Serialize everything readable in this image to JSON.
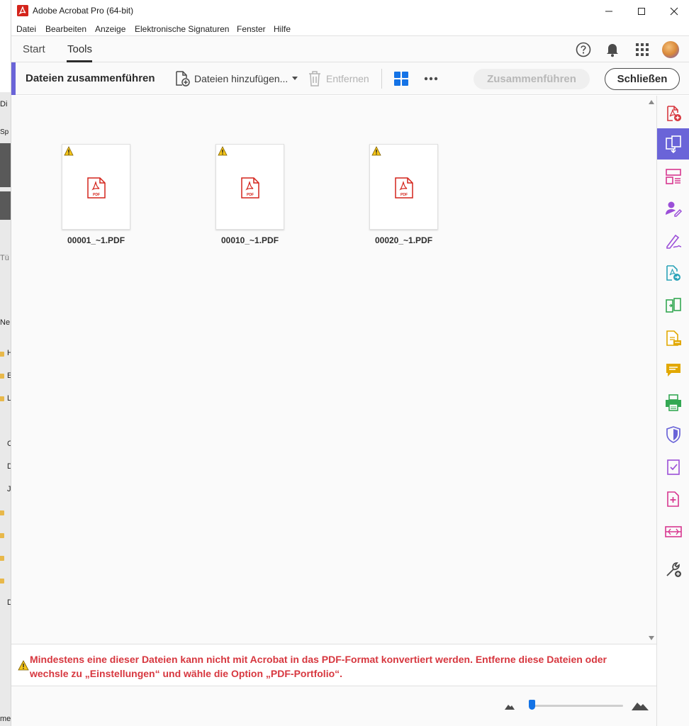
{
  "window": {
    "title": "Adobe Acrobat Pro (64-bit)"
  },
  "menu": [
    "Datei",
    "Bearbeiten",
    "Anzeige",
    "Elektronische Signaturen",
    "Fenster",
    "Hilfe"
  ],
  "tabs": {
    "start": "Start",
    "tools": "Tools",
    "active": "Tools"
  },
  "toolbar": {
    "title": "Dateien zusammenführen",
    "add_files": "Dateien hinzufügen...",
    "remove": "Entfernen",
    "merge": "Zusammenführen",
    "close": "Schließen"
  },
  "files": [
    {
      "name": "00001_~1.PDF",
      "warning": true,
      "icon": "pdf-file-icon"
    },
    {
      "name": "00010_~1.PDF",
      "warning": true,
      "icon": "pdf-file-icon"
    },
    {
      "name": "00020_~1.PDF",
      "warning": true,
      "icon": "pdf-file-icon"
    }
  ],
  "warning": {
    "line1": "Mindestens eine dieser Dateien kann nicht mit Acrobat in das PDF-Format konvertiert werden. Entferne diese Dateien oder",
    "line2": "wechsle zu „Einstellungen“ und wähle die Option „PDF-Portfolio“."
  },
  "background_window": {
    "fragments": [
      "Di",
      "Sp",
      "Tü",
      "Ne",
      "H",
      "E",
      "L",
      "C",
      "D",
      "J",
      "D",
      "me"
    ]
  },
  "rail_tools": [
    "create-pdf-icon",
    "combine-files-icon",
    "organize-pages-icon",
    "request-signature-icon",
    "fill-sign-icon",
    "export-pdf-icon",
    "compare-files-icon",
    "scan-ocr-icon",
    "comment-icon",
    "print-production-icon",
    "protect-icon",
    "prepare-form-icon",
    "add-page-icon",
    "edit-pdf-icon",
    "more-tools-icon"
  ],
  "colors": {
    "accent": "#6a64d8",
    "warning_text": "#d7373f",
    "pdf_red": "#d4241b",
    "primary_blue": "#1473e6"
  }
}
